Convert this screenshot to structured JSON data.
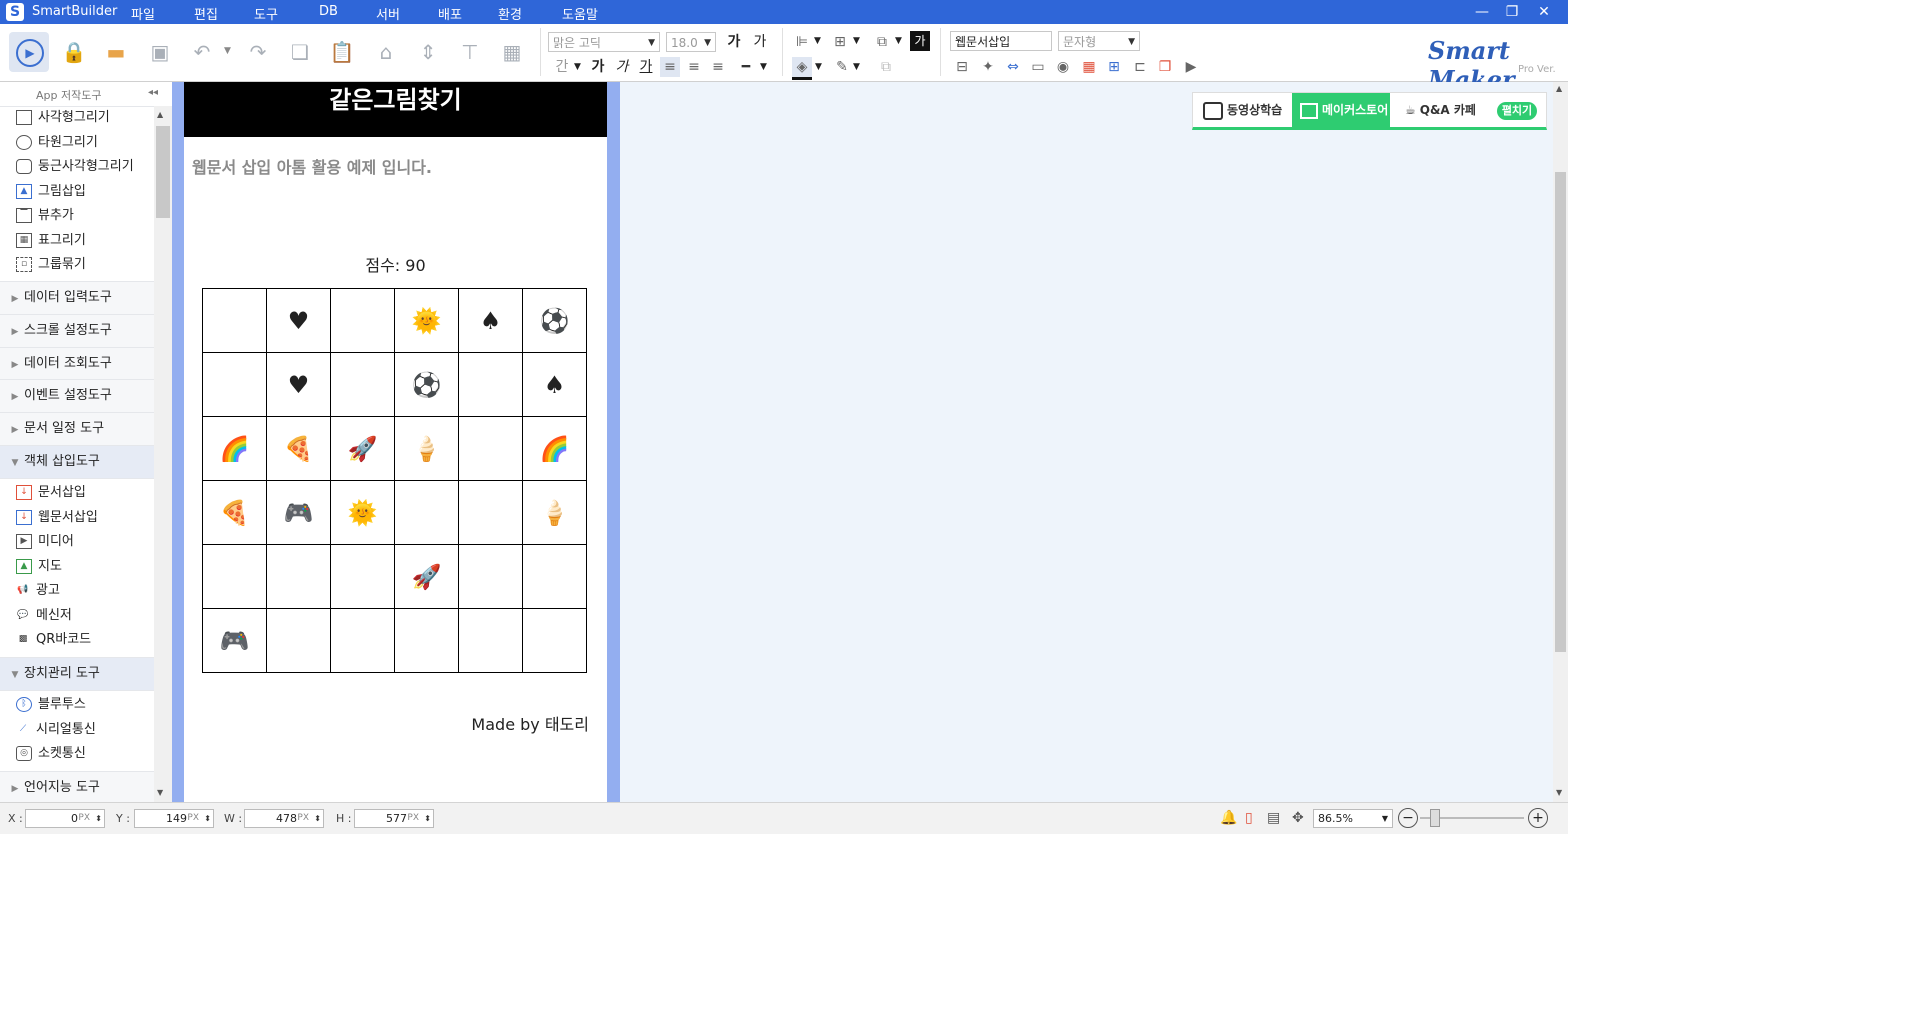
{
  "app": {
    "name": "SmartBuilder",
    "menu": [
      "파일",
      "편집",
      "도구",
      "DB",
      "서버",
      "배포",
      "환경",
      "도움말"
    ]
  },
  "toolbar": {
    "font_name": "맑은 고딕",
    "font_size": "18.0",
    "component_name": "웹문서삽입",
    "component_type": "문자형",
    "text_glyph": "가"
  },
  "brand": {
    "title": "Smart Maker",
    "sub": "Pro Ver."
  },
  "links": [
    {
      "label": "동영상학습"
    },
    {
      "label": "메이커스토어"
    },
    {
      "label": "Q&A 카페"
    },
    {
      "label": "펼치기"
    }
  ],
  "left_panel": {
    "header": "App 저작도구",
    "draw_items": [
      "사각형그리기",
      "타원그리기",
      "둥근사각형그리기",
      "그림삽입",
      "뷰추가",
      "표그리기",
      "그룹묶기"
    ],
    "sections_collapsed": [
      "데이터 입력도구",
      "스크롤 설정도구",
      "데이터 조회도구",
      "이벤트 설정도구",
      "문서 일정 도구"
    ],
    "object_section": "객체 삽입도구",
    "object_items": [
      "문서삽입",
      "웹문서삽입",
      "미디어",
      "지도",
      "광고",
      "메신저",
      "QR바코드"
    ],
    "device_section": "장치관리 도구",
    "device_items": [
      "블루투스",
      "시리얼통신",
      "소켓통신"
    ],
    "ai_section": "언어지능 도구"
  },
  "page": {
    "title": "같은그림찾기",
    "subtitle": "웹문서 삽입 아톰 활용 예제 입니다.",
    "score_label": "점수: 90",
    "grid": [
      [
        "",
        "♥",
        "",
        "🌞",
        "♠",
        "⚽"
      ],
      [
        "",
        "♥",
        "",
        "⚽",
        "",
        "♠"
      ],
      [
        "🌈",
        "🍕",
        "🚀",
        "🍦",
        "",
        "🌈"
      ],
      [
        "🍕",
        "🎮",
        "🌞",
        "",
        "",
        "🍦"
      ],
      [
        "",
        "",
        "",
        "🚀",
        "",
        ""
      ],
      [
        "🎮",
        "",
        "",
        "",
        "",
        ""
      ]
    ],
    "credit": "Made by 태도리"
  },
  "status": {
    "x_label": "X :",
    "x_value": "0",
    "y_label": "Y :",
    "y_value": "149",
    "w_label": "W :",
    "w_value": "478",
    "h_label": "H :",
    "h_value": "577",
    "unit": "PX",
    "zoom": "86.5%"
  },
  "colors": {
    "titlebar": "#2f66d8",
    "accent_green": "#2ecc71",
    "side_strip": "#93aef0",
    "workspace": "#eef4fb"
  }
}
